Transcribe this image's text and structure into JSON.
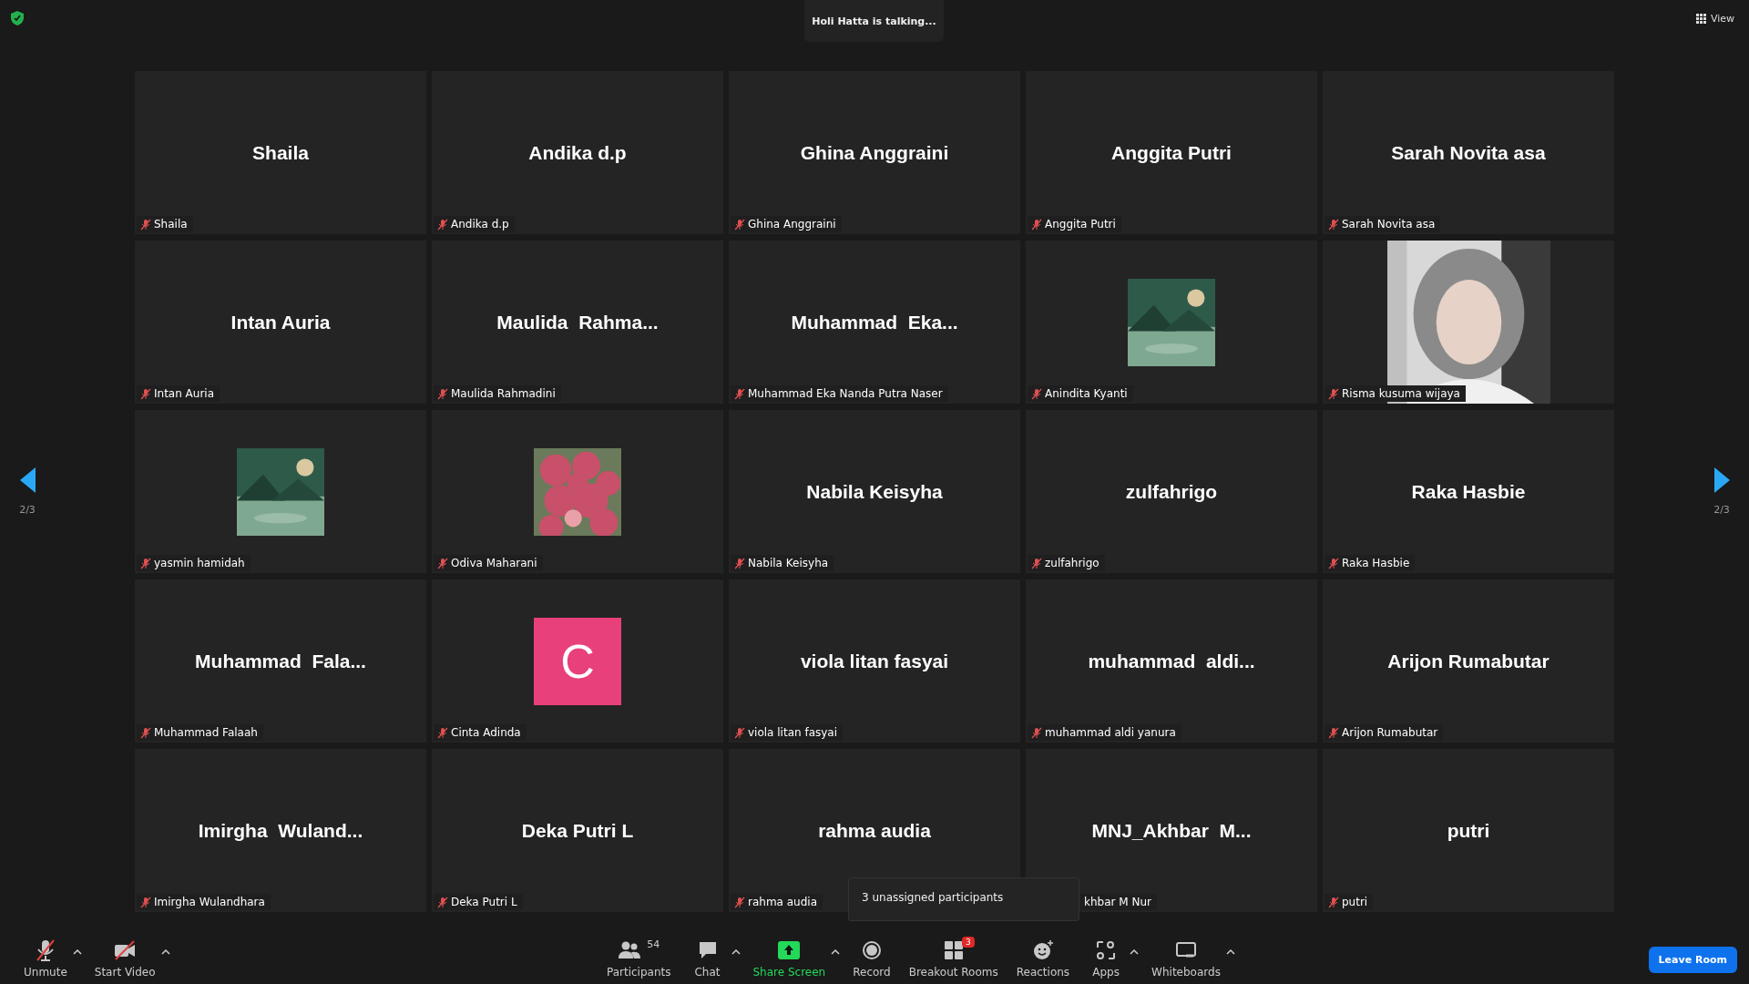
{
  "top_bar": {
    "speaker_banner": "Holi Hatta is talking...",
    "view_button": "View"
  },
  "pager": {
    "left": "2/3",
    "right": "2/3"
  },
  "tiles": [
    {
      "kind": "name",
      "display": "Shaila",
      "label": "Shaila",
      "muted": true
    },
    {
      "kind": "name",
      "display": "Andika d.p",
      "label": "Andika d.p",
      "muted": true
    },
    {
      "kind": "name",
      "display": "Ghina Anggraini",
      "label": "Ghina Anggraini",
      "muted": true
    },
    {
      "kind": "name",
      "display": "Anggita Putri",
      "label": "Anggita Putri",
      "muted": true
    },
    {
      "kind": "name",
      "display": "Sarah Novita asa",
      "label": "Sarah Novita asa",
      "muted": true
    },
    {
      "kind": "name",
      "display": "Intan Auria",
      "label": "Intan Auria",
      "muted": true
    },
    {
      "kind": "name",
      "display": "Maulida  Rahma...",
      "label": "Maulida Rahmadini",
      "muted": true
    },
    {
      "kind": "name",
      "display": "Muhammad  Eka...",
      "label": "Muhammad Eka Nanda Putra Naser",
      "muted": true
    },
    {
      "kind": "thumbnail",
      "label": "Anindita Kyanti",
      "muted": true
    },
    {
      "kind": "picture",
      "label": "Risma kusuma wijaya",
      "muted": true
    },
    {
      "kind": "thumbnail",
      "label": "yasmin hamidah",
      "muted": true
    },
    {
      "kind": "thumbnail",
      "label": "Odiva Maharani",
      "muted": true
    },
    {
      "kind": "name",
      "display": "Nabila Keisyha",
      "label": "Nabila Keisyha",
      "muted": true
    },
    {
      "kind": "name",
      "display": "zulfahrigo",
      "label": "zulfahrigo",
      "muted": true
    },
    {
      "kind": "name",
      "display": "Raka Hasbie",
      "label": "Raka Hasbie",
      "muted": true
    },
    {
      "kind": "name",
      "display": "Muhammad  Fala...",
      "label": "Muhammad Falaah",
      "muted": true
    },
    {
      "kind": "avatar",
      "letter": "C",
      "label": "Cinta Adinda",
      "muted": true
    },
    {
      "kind": "name",
      "display": "viola litan fasyai",
      "label": "viola litan fasyai",
      "muted": true
    },
    {
      "kind": "name",
      "display": "muhammad  aldi...",
      "label": "muhammad aldi yanura",
      "muted": true
    },
    {
      "kind": "name",
      "display": "Arijon Rumabutar",
      "label": "Arijon Rumabutar",
      "muted": true
    },
    {
      "kind": "name",
      "display": "Imirgha  Wuland...",
      "label": "Imirgha Wulandhara",
      "muted": true
    },
    {
      "kind": "name",
      "display": "Deka Putri L",
      "label": "Deka Putri L",
      "muted": true
    },
    {
      "kind": "name",
      "display": "rahma audia",
      "label": "rahma audia",
      "muted": true
    },
    {
      "kind": "name",
      "display": "MNJ_Akhbar  M...",
      "label": "khbar M Nur",
      "covered": true
    },
    {
      "kind": "name",
      "display": "putri",
      "label": "putri",
      "muted": true
    }
  ],
  "tooltip": "3 unassigned participants",
  "toolbar": {
    "left": [
      {
        "kind": "mic",
        "label": "Unmute",
        "caret": true
      },
      {
        "kind": "video",
        "label": "Start Video",
        "caret": true
      }
    ],
    "center": [
      {
        "kind": "participants",
        "label": "Participants",
        "count": "54",
        "caret": false
      },
      {
        "kind": "chat",
        "label": "Chat",
        "caret": true
      },
      {
        "kind": "share",
        "label": "Share Screen",
        "caret": true,
        "highlighted": true
      },
      {
        "kind": "record",
        "label": "Record",
        "caret": false
      },
      {
        "kind": "breakout",
        "label": "Breakout Rooms",
        "badge": "3",
        "caret": false
      },
      {
        "kind": "reactions",
        "label": "Reactions",
        "caret": false
      },
      {
        "kind": "apps",
        "label": "Apps",
        "caret": true
      },
      {
        "kind": "whiteboard",
        "label": "Whiteboards",
        "caret": true
      }
    ],
    "leave_button": "Leave Room"
  }
}
